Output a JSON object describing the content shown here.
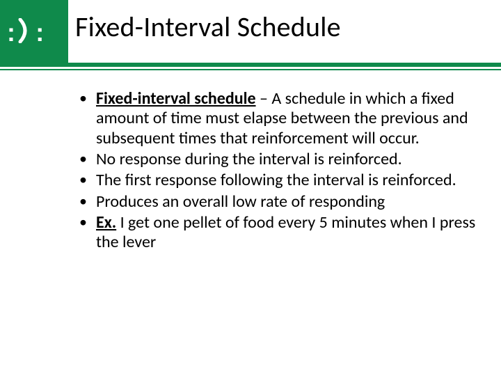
{
  "header": {
    "title": "Fixed-Interval Schedule"
  },
  "bullets": [
    {
      "lead_bold_underline": "Fixed-interval schedule",
      "rest": " – A schedule in which a fixed amount of time must elapse between the previous and subsequent times that reinforcement will occur."
    },
    {
      "lead_bold_underline": "",
      "rest": "No response during the interval is reinforced."
    },
    {
      "lead_bold_underline": "",
      "rest": "The first response following the interval is reinforced."
    },
    {
      "lead_bold_underline": "",
      "rest": "Produces an overall low rate of responding"
    },
    {
      "lead_bold_underline": "Ex.",
      "rest": " I get one pellet of food every 5 minutes when I press the lever"
    }
  ],
  "logo": {
    "name": "smile-colon-logo"
  },
  "colors": {
    "accent": "#0f8a4b"
  }
}
